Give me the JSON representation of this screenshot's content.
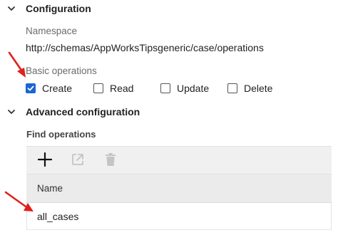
{
  "configuration": {
    "title": "Configuration",
    "namespace_label": "Namespace",
    "namespace_value": "http://schemas/AppWorksTipsgeneric/case/operations",
    "basic_operations_label": "Basic operations",
    "operations": [
      {
        "label": "Create",
        "checked": true
      },
      {
        "label": "Read",
        "checked": false
      },
      {
        "label": "Update",
        "checked": false
      },
      {
        "label": "Delete",
        "checked": false
      }
    ]
  },
  "advanced": {
    "title": "Advanced configuration",
    "find_operations_label": "Find operations",
    "toolbar": {
      "add_icon": "plus-icon",
      "open_icon": "open-external-icon",
      "delete_icon": "trash-icon"
    },
    "column_header": "Name",
    "rows": [
      {
        "name": "all_cases"
      }
    ]
  },
  "colors": {
    "checkbox_checked": "#1967d2",
    "annotation_arrow": "#e0201c"
  }
}
